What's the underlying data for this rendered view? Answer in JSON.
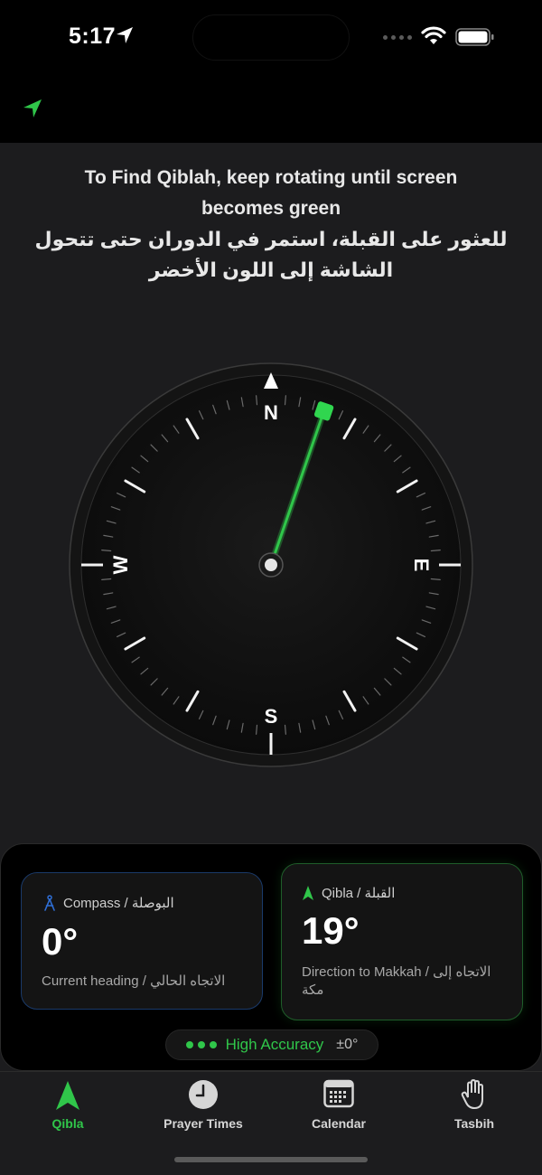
{
  "status_bar": {
    "time": "5:17"
  },
  "instructions": {
    "english": "To Find Qiblah, keep rotating until screen becomes green",
    "arabic": "للعثور على القبلة، استمر في الدوران حتى تتحول الشاشة إلى اللون الأخضر"
  },
  "compass": {
    "cardinals": {
      "north": "N",
      "east": "E",
      "south": "S",
      "west": "W"
    },
    "qibla_bearing_deg": 19,
    "heading_deg": 0
  },
  "cards": {
    "compass": {
      "title": "Compass / البوصلة",
      "value": "0°",
      "subtitle": "Current heading / الاتجاه الحالي"
    },
    "qibla": {
      "title": "Qibla / القبلة",
      "value": "19°",
      "subtitle": "Direction to Makkah / الاتجاه إلى مكة"
    }
  },
  "accuracy": {
    "label": "High Accuracy",
    "value": "±0°"
  },
  "tabs": [
    {
      "label": "Qibla",
      "icon": "qibla-arrow-icon",
      "active": true
    },
    {
      "label": "Prayer Times",
      "icon": "clock-icon",
      "active": false
    },
    {
      "label": "Calendar",
      "icon": "calendar-icon",
      "active": false
    },
    {
      "label": "Tasbih",
      "icon": "hand-icon",
      "active": false
    }
  ],
  "colors": {
    "accent_green": "#30c64a",
    "compass_blue": "#2f6fd6",
    "background": "#1c1c1e"
  }
}
